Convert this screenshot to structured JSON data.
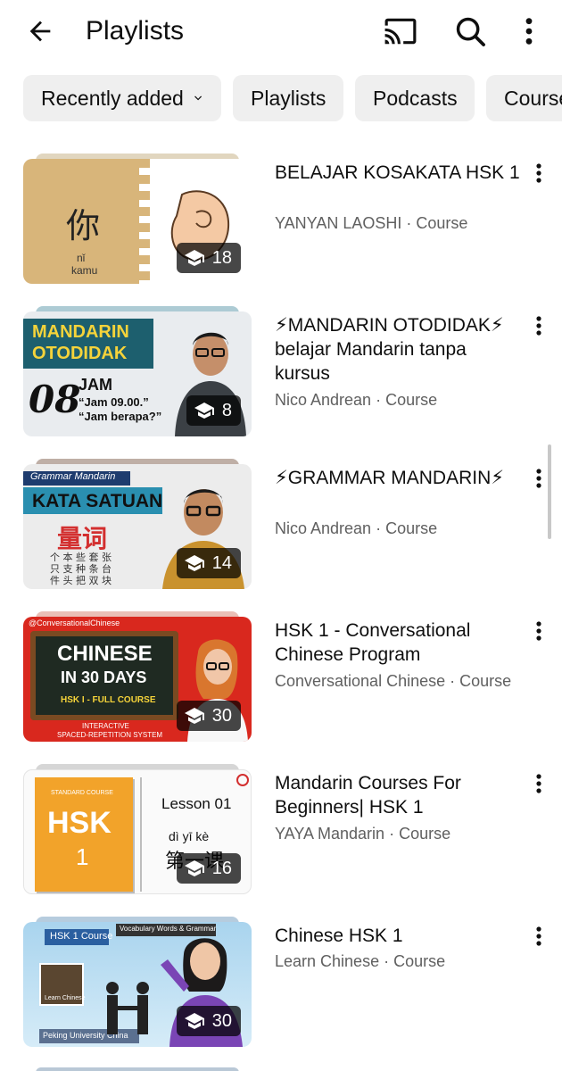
{
  "header": {
    "title": "Playlists",
    "back_icon": "arrow-left-icon",
    "cast_icon": "cast-icon",
    "search_icon": "search-icon",
    "more_icon": "more-vertical-icon"
  },
  "chips": [
    {
      "label": "Recently added",
      "has_dropdown": true
    },
    {
      "label": "Playlists"
    },
    {
      "label": "Podcasts"
    },
    {
      "label": "Course"
    }
  ],
  "playlists": [
    {
      "title": "BELAJAR KOSAKATA HSK 1",
      "channel": "YANYAN LAOSHI",
      "separator": " · ",
      "type": "Course",
      "count": "18",
      "thumb": {
        "char": "你",
        "pinyin": "nǐ",
        "meaning": "kamu"
      }
    },
    {
      "title": "⚡MANDARIN OTODIDAK⚡ belajar Mandarin tanpa kursus",
      "channel": "Nico Andrean",
      "separator": " · ",
      "type": "Course",
      "count": "8",
      "thumb": {
        "line1": "MANDARIN",
        "line2": "OTODIDAK",
        "num": "08",
        "word": "JAM",
        "q1": "“Jam 09.00.”",
        "q2": "“Jam berapa?”"
      }
    },
    {
      "title": "⚡GRAMMAR MANDARIN⚡",
      "channel": "Nico Andrean",
      "separator": " · ",
      "type": "Course",
      "count": "14",
      "thumb": {
        "tag": "Grammar Mandarin",
        "heading": "KATA SATUAN",
        "hanzi": "量词",
        "grid": [
          "个 本 些 套 张",
          "只 支 种 条 台",
          "件 头 把 双 块"
        ]
      }
    },
    {
      "title": "HSK 1 - Conversational Chinese Program",
      "channel": "Conversational Chinese ",
      "separator": " · ",
      "type": "Course",
      "count": "30",
      "thumb": {
        "handle": "@ConversationalChinese",
        "board1": "CHINESE",
        "board2": "IN 30 DAYS",
        "board3": "HSK I - FULL COURSE",
        "footer1": "INTERACTIVE",
        "footer2": "SPACED-REPETITION SYSTEM"
      }
    },
    {
      "title": "Mandarin Courses For Beginners| HSK 1",
      "channel": "YAYA Mandarin",
      "separator": " · ",
      "type": "Course",
      "count": "16",
      "thumb": {
        "book": "HSK",
        "book_num": "1",
        "book_sub": "STANDARD COURSE",
        "lesson": "Lesson 01",
        "pinyin": "dì   yī   kè",
        "hanzi": "第一课"
      }
    },
    {
      "title": "Chinese HSK 1",
      "channel": "Learn Chinese",
      "separator": " · ",
      "type": "Course",
      "count": "30",
      "thumb": {
        "tag1": "HSK 1 Course",
        "tag2": "Vocabulary Words & Grammar",
        "small": "Learn Chinese",
        "footer": "Peking University China"
      }
    }
  ],
  "colors": {
    "chip_bg": "#efefef",
    "secondary_text": "#606060",
    "badge_bg": "#000000b8"
  }
}
